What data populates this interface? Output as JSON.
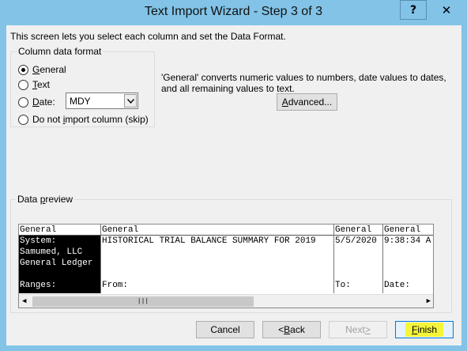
{
  "window": {
    "title": "Text Import Wizard - Step 3 of 3",
    "help_label": "?",
    "close_label": "✕"
  },
  "intro_text": "This screen lets you select each column and set the Data Format.",
  "column_format": {
    "group_label": "Column data format",
    "options": [
      {
        "pre": "",
        "key": "G",
        "post": "eneral",
        "selected": true
      },
      {
        "pre": "",
        "key": "T",
        "post": "ext",
        "selected": false
      },
      {
        "pre": "",
        "key": "D",
        "post": "ate:",
        "selected": false
      },
      {
        "pre": "Do not ",
        "key": "i",
        "post": "mport column (skip)",
        "selected": false
      }
    ],
    "date_format": "MDY",
    "dropdown_icon": "chevron-down-icon"
  },
  "info_text": "'General' converts numeric values to numbers, date values to dates, and all remaining values to text.",
  "advanced_button": {
    "pre": "",
    "key": "A",
    "post": "dvanced..."
  },
  "preview": {
    "label_pre": "Data ",
    "label_key": "p",
    "label_post": "review",
    "columns": [
      {
        "header": "General",
        "cells": [
          "System:",
          "Samumed, LLC",
          "General Ledger",
          "",
          "Ranges:"
        ],
        "selected": true
      },
      {
        "header": "General",
        "cells": [
          "HISTORICAL TRIAL BALANCE SUMMARY FOR 2019",
          "",
          "",
          "",
          "From:"
        ],
        "selected": false
      },
      {
        "header": "General",
        "cells": [
          "5/5/2020",
          "",
          "",
          "",
          "To:"
        ],
        "selected": false
      },
      {
        "header": "General",
        "cells": [
          "9:38:34 A",
          "",
          "",
          "",
          "Date:"
        ],
        "selected": false
      }
    ]
  },
  "buttons": {
    "cancel": "Cancel",
    "back_prefix": "< ",
    "back_key": "B",
    "back_post": "ack",
    "next_pre": "Next ",
    "next_key": ">",
    "finish_key": "F",
    "finish_post": "inish"
  },
  "colors": {
    "title_bar": "#82c3e7",
    "dialog_bg": "#f0f0f0",
    "finish_highlight": "#f5f53a"
  }
}
